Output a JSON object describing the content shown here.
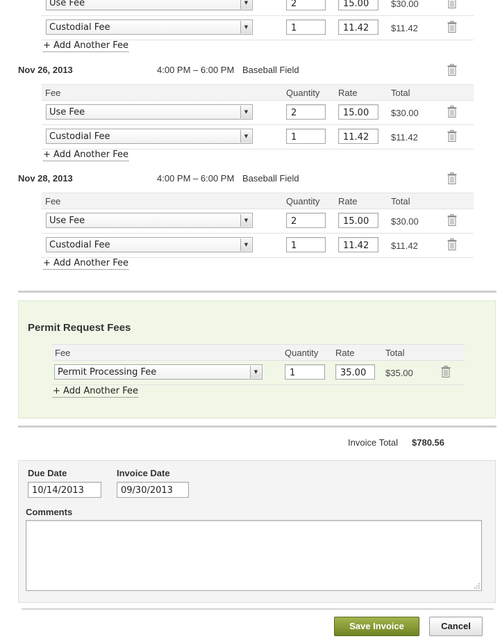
{
  "table_headers": {
    "fee": "Fee",
    "quantity": "Quantity",
    "rate": "Rate",
    "total": "Total"
  },
  "add_fee_label": "+ Add Another Fee",
  "bookings": [
    {
      "date": "",
      "time": "",
      "location": "",
      "fees": [
        {
          "name": "Use Fee",
          "quantity": "2",
          "rate": "15.00",
          "total": "$30.00"
        },
        {
          "name": "Custodial Fee",
          "quantity": "1",
          "rate": "11.42",
          "total": "$11.42"
        }
      ]
    },
    {
      "date": "Nov 26, 2013",
      "time": "4:00 PM – 6:00 PM",
      "location": "Baseball Field",
      "fees": [
        {
          "name": "Use Fee",
          "quantity": "2",
          "rate": "15.00",
          "total": "$30.00"
        },
        {
          "name": "Custodial Fee",
          "quantity": "1",
          "rate": "11.42",
          "total": "$11.42"
        }
      ]
    },
    {
      "date": "Nov 28, 2013",
      "time": "4:00 PM – 6:00 PM",
      "location": "Baseball Field",
      "fees": [
        {
          "name": "Use Fee",
          "quantity": "2",
          "rate": "15.00",
          "total": "$30.00"
        },
        {
          "name": "Custodial Fee",
          "quantity": "1",
          "rate": "11.42",
          "total": "$11.42"
        }
      ]
    }
  ],
  "permit": {
    "title": "Permit Request Fees",
    "fees": [
      {
        "name": "Permit Processing Fee",
        "quantity": "1",
        "rate": "35.00",
        "total": "$35.00"
      }
    ]
  },
  "invoice": {
    "total_label": "Invoice Total",
    "total_value": "$780.56",
    "due_date_label": "Due Date",
    "due_date": "10/14/2013",
    "invoice_date_label": "Invoice Date",
    "invoice_date": "09/30/2013",
    "comments_label": "Comments",
    "comments": ""
  },
  "buttons": {
    "save": "Save Invoice",
    "cancel": "Cancel"
  },
  "icons": {
    "delete": "trash-icon",
    "dropdown": "chevron-down-icon",
    "resize": "resize-grip-icon"
  },
  "colors": {
    "permit_panel": "#f1f7e6",
    "save_button": "#7d932c",
    "details_panel": "#f4f4f4"
  }
}
